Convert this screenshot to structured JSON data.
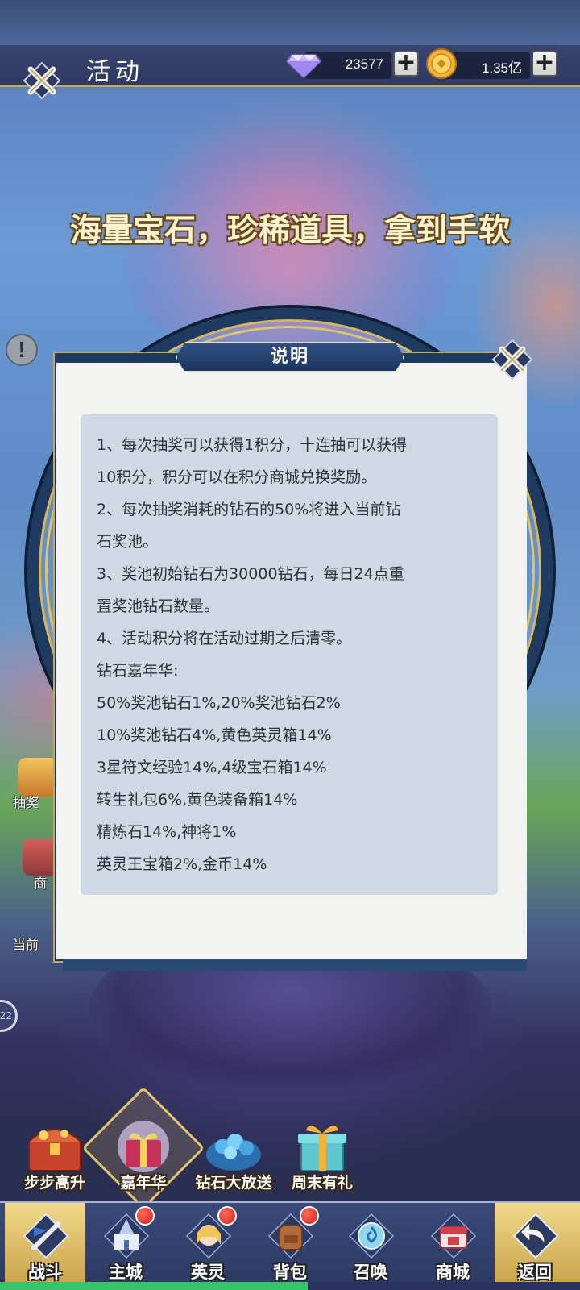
{
  "header": {
    "title": "活动",
    "diamonds": "23577",
    "gold": "1.35亿"
  },
  "slogan": "海量宝石，珍稀道具，拿到手软",
  "side": {
    "lottery_label": "抽奖",
    "shop_label": "商",
    "current_label": "当前",
    "circle_text": "22"
  },
  "dialog": {
    "title": "说明",
    "lines": [
      "1、每次抽奖可以获得1积分，十连抽可以获得",
      "10积分，积分可以在积分商城兑换奖励。",
      "2、每次抽奖消耗的钻石的50%将进入当前钻",
      "石奖池。",
      "3、奖池初始钻石为30000钻石，每日24点重",
      "置奖池钻石数量。",
      "4、活动积分将在活动过期之后清零。",
      "钻石嘉年华:",
      "50%奖池钻石1%,20%奖池钻石2%",
      "10%奖池钻石4%,黄色英灵箱14%",
      "3星符文经验14%,4级宝石箱14%",
      "转生礼包6%,黄色装备箱14%",
      "精炼石14%,神将1%",
      "英灵王宝箱2%,金币14%"
    ]
  },
  "event_tabs": [
    {
      "label": "步步高升"
    },
    {
      "label": "嘉年华"
    },
    {
      "label": "钻石大放送"
    },
    {
      "label": "周末有礼"
    }
  ],
  "nav": [
    {
      "label": "战斗"
    },
    {
      "label": "主城"
    },
    {
      "label": "英灵"
    },
    {
      "label": "背包"
    },
    {
      "label": "召唤"
    },
    {
      "label": "商城"
    },
    {
      "label": "返回"
    }
  ],
  "colors": {
    "accent_gold": "#c9a94f",
    "dialog_frame": "#1b3a5e",
    "info_box": "#cfd9e3",
    "badge_red": "#d4221a",
    "progress_green": "#36c46a"
  },
  "icons": {
    "close": "close-x-icon",
    "diamond": "diamond-icon",
    "gold": "gold-coin-icon",
    "plus": "plus-icon",
    "alert": "exclamation-icon",
    "back": "back-arrow-icon"
  },
  "progress": 0.53
}
